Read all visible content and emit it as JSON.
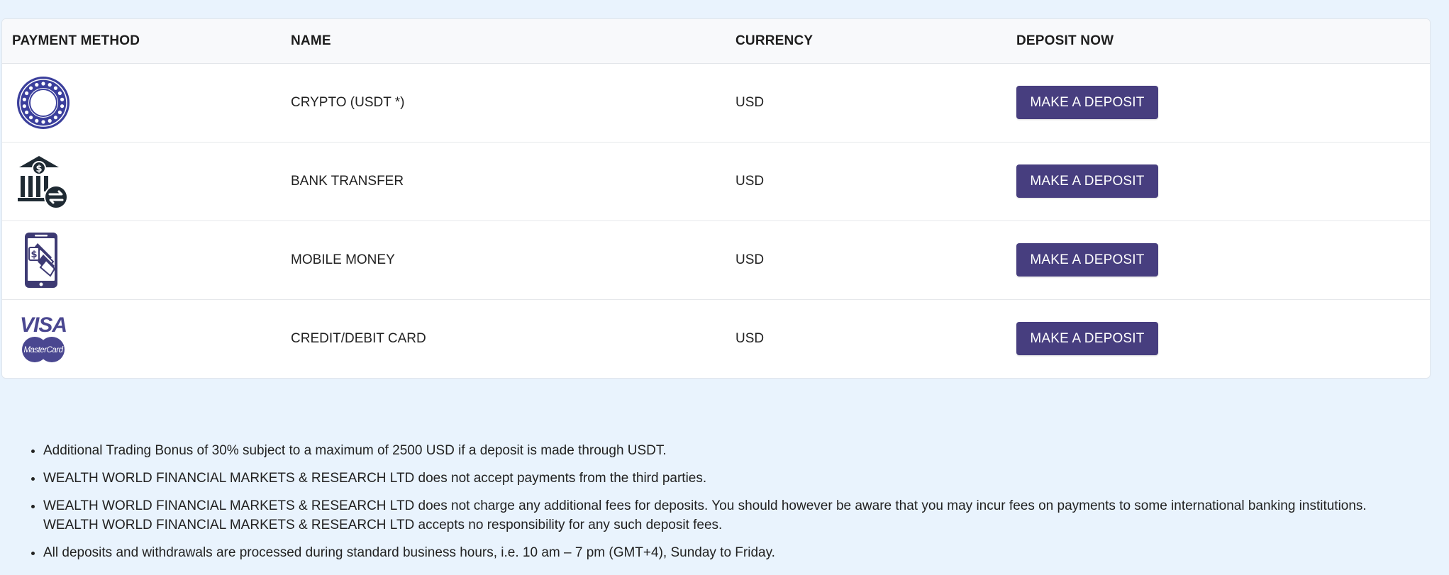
{
  "table": {
    "headers": {
      "method": "PAYMENT METHOD",
      "name": "NAME",
      "currency": "CURRENCY",
      "deposit": "DEPOSIT NOW"
    },
    "rows": [
      {
        "icon": "crypto-coin-icon",
        "name": "CRYPTO (USDT *)",
        "currency": "USD",
        "button": "MAKE A DEPOSIT"
      },
      {
        "icon": "bank-transfer-icon",
        "name": "BANK TRANSFER",
        "currency": "USD",
        "button": "MAKE A DEPOSIT"
      },
      {
        "icon": "mobile-money-icon",
        "name": "MOBILE MONEY",
        "currency": "USD",
        "button": "MAKE A DEPOSIT"
      },
      {
        "icon": "visa-mastercard-icon",
        "name": "CREDIT/DEBIT CARD",
        "currency": "USD",
        "button": "MAKE A DEPOSIT",
        "logo_text_1": "VISA",
        "logo_text_2": "MasterCard"
      }
    ]
  },
  "notes": [
    "Additional Trading Bonus of 30% subject to a maximum of 2500 USD if a deposit is made through USDT.",
    "WEALTH WORLD FINANCIAL MARKETS & RESEARCH LTD does not accept payments from the third parties.",
    "WEALTH WORLD FINANCIAL MARKETS & RESEARCH LTD does not charge any additional fees for deposits. You should however be aware that you may incur fees on payments to some international banking institutions. WEALTH WORLD FINANCIAL MARKETS & RESEARCH LTD accepts no responsibility for any such deposit fees.",
    "All deposits and withdrawals are processed during standard business hours, i.e. 10 am – 7 pm (GMT+4), Sunday to Friday."
  ],
  "colors": {
    "page_background": "#e9f3fd",
    "button_background": "#473e7f",
    "icon_primary": "#3b3f9c",
    "icon_dark": "#1f2a33"
  }
}
